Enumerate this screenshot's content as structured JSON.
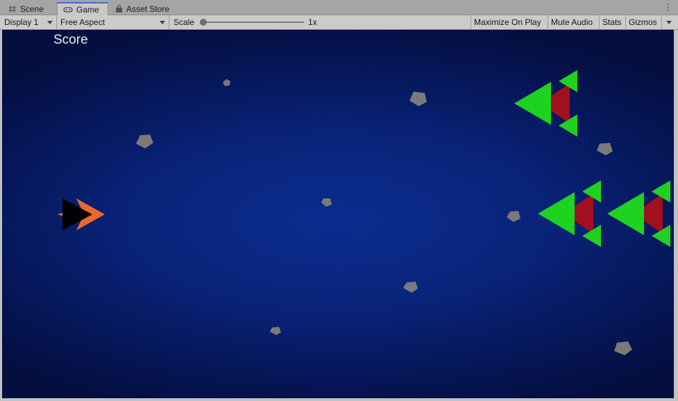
{
  "tabs": [
    {
      "label": "Scene",
      "icon": "grid-icon",
      "active": false
    },
    {
      "label": "Game",
      "icon": "gamepad-icon",
      "active": true
    },
    {
      "label": "Asset Store",
      "icon": "shopping-bag-icon",
      "active": false
    }
  ],
  "toolbar": {
    "display": "Display 1",
    "aspect": "Free Aspect",
    "scale_label": "Scale",
    "scale_value": "1x",
    "maximize": "Maximize On Play",
    "mute": "Mute Audio",
    "stats": "Stats",
    "gizmos": "Gizmos"
  },
  "game": {
    "score_label": "Score",
    "colors": {
      "player_body": "#000000",
      "player_fin": "#e8692f",
      "enemy_wing": "#1fd21f",
      "enemy_core": "#a0101f",
      "asteroid": "#7a7a7a"
    }
  }
}
